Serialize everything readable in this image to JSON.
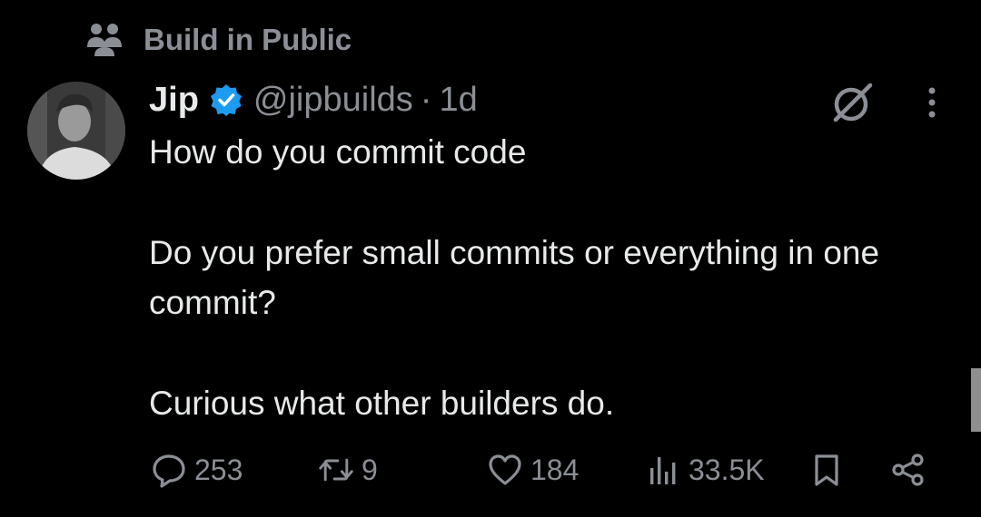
{
  "community": {
    "name": "Build in Public",
    "icon": "community-people-icon"
  },
  "author": {
    "name": "Jip",
    "verified": true,
    "verified_color": "#1d9bf0",
    "handle": "@jipbuilds",
    "separator": "·",
    "time": "1d"
  },
  "tweet": {
    "line1": "How do you commit code",
    "line2": "Do you prefer small commits or everything in one commit?",
    "line3": "Curious what other builders do."
  },
  "actions": {
    "replies": "253",
    "reposts": "9",
    "likes": "184",
    "views": "33.5K"
  },
  "colors": {
    "background": "#000000",
    "text": "#e7e9ea",
    "muted": "#8b8f95"
  }
}
